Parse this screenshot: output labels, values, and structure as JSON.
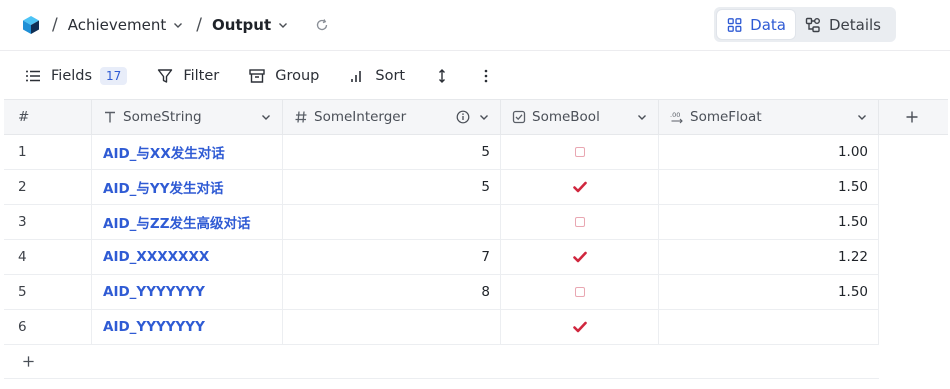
{
  "breadcrumb": {
    "project": "Achievement",
    "table": "Output"
  },
  "view_switch": {
    "data_label": "Data",
    "details_label": "Details"
  },
  "toolbar": {
    "fields_label": "Fields",
    "fields_count": "17",
    "filter_label": "Filter",
    "group_label": "Group",
    "sort_label": "Sort"
  },
  "columns": {
    "index": "#",
    "c1": "SomeString",
    "c2": "SomeInterger",
    "c3": "SomeBool",
    "c4": "SomeFloat"
  },
  "rows": [
    {
      "n": "1",
      "s": "AID_与XX发生对话",
      "i": "5",
      "b": false,
      "f": "1.00"
    },
    {
      "n": "2",
      "s": "AID_与YY发生对话",
      "i": "5",
      "b": true,
      "f": "1.50"
    },
    {
      "n": "3",
      "s": "AID_与ZZ发生高级对话",
      "i": "",
      "b": false,
      "f": "1.50"
    },
    {
      "n": "4",
      "s": "AID_XXXXXXX",
      "i": "7",
      "b": true,
      "f": "1.22"
    },
    {
      "n": "5",
      "s": "AID_YYYYYYY",
      "i": "8",
      "b": false,
      "f": "1.50"
    },
    {
      "n": "6",
      "s": "AID_YYYYYYY",
      "i": "",
      "b": true,
      "f": ""
    }
  ],
  "colors": {
    "accent": "#2f5bd4",
    "check": "#d0273e",
    "checkbox_empty": "#e9a7b2",
    "logo": "#1ea3e6"
  },
  "icons": {
    "logo": "cube-icon",
    "refresh": "refresh-icon",
    "data": "grid-icon",
    "details": "nodes-icon",
    "fields": "list-icon",
    "filter": "filter-icon",
    "group": "archive-icon",
    "sort": "bar-chart-icon",
    "row_height": "arrows-vertical-icon",
    "more": "more-vertical-icon",
    "add": "plus-icon"
  }
}
